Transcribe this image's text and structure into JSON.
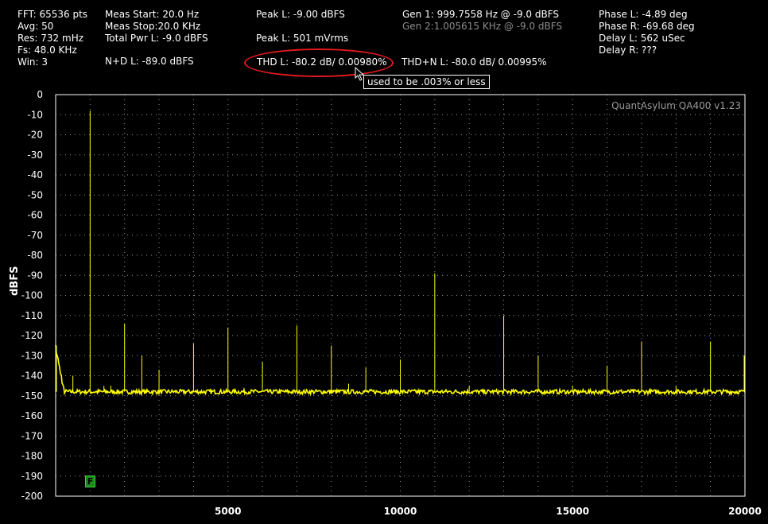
{
  "header": {
    "col1": [
      "FFT: 65536 pts",
      "Avg: 50",
      "Res: 732 mHz",
      "Fs: 48.0 KHz",
      "Win: 3"
    ],
    "col2": [
      "Meas Start: 20.0 Hz",
      "Meas Stop:20.0 KHz",
      "Total Pwr L: -9.0 dBFS"
    ],
    "nd": "N+D L: -89.0 dBFS",
    "peak_l": "Peak L: -9.00 dBFS",
    "peak_l_v": "Peak L: 501 mVrms",
    "thd": "THD L: -80.2 dB/ 0.00980%",
    "thdn": "THD+N L: -80.0 dB/ 0.00995%",
    "gen1": "Gen 1: 999.7558 Hz @ -9.0  dBFS",
    "gen2": "Gen 2:1.005615 KHz @ -9.0  dBFS",
    "col5": [
      "Phase L: -4.89 deg",
      "Phase R: -69.68 deg",
      "Delay L: 562 uSec",
      "Delay R: ???"
    ]
  },
  "annotation": {
    "note": "used to be .003% or less",
    "highlight_color": "#e1191e"
  },
  "marker_label": "F",
  "chart_data": {
    "type": "line",
    "ylabel": "dBFS",
    "xlabel": "",
    "brand": "QuantAsylum QA400 v1.23",
    "xlim": [
      0,
      20000
    ],
    "ylim": [
      -200,
      0
    ],
    "xticks": [
      5000,
      10000,
      15000,
      20000
    ],
    "yticks": [
      0,
      -10,
      -20,
      -30,
      -40,
      -50,
      -60,
      -70,
      -80,
      -90,
      -100,
      -110,
      -120,
      -130,
      -140,
      -150,
      -160,
      -170,
      -180,
      -190,
      -200
    ],
    "grid": true,
    "colors": {
      "trace": "#ffff00",
      "grid": "#bdbdbd",
      "axes": "#ffffff"
    },
    "noise_floor": -148,
    "peaks": [
      {
        "x": 0,
        "y": -125
      },
      {
        "x": 500,
        "y": -140
      },
      {
        "x": 1000,
        "y": -8
      },
      {
        "x": 1400,
        "y": -145
      },
      {
        "x": 1600,
        "y": -145
      },
      {
        "x": 2000,
        "y": -114
      },
      {
        "x": 2500,
        "y": -130
      },
      {
        "x": 3000,
        "y": -137
      },
      {
        "x": 4000,
        "y": -124
      },
      {
        "x": 5000,
        "y": -116
      },
      {
        "x": 6000,
        "y": -133
      },
      {
        "x": 7000,
        "y": -115
      },
      {
        "x": 8000,
        "y": -125
      },
      {
        "x": 8500,
        "y": -144
      },
      {
        "x": 9000,
        "y": -136
      },
      {
        "x": 10000,
        "y": -132
      },
      {
        "x": 11000,
        "y": -89
      },
      {
        "x": 12000,
        "y": -145
      },
      {
        "x": 13000,
        "y": -110
      },
      {
        "x": 14000,
        "y": -130
      },
      {
        "x": 15000,
        "y": -145
      },
      {
        "x": 16000,
        "y": -135
      },
      {
        "x": 17000,
        "y": -123
      },
      {
        "x": 18000,
        "y": -145
      },
      {
        "x": 19000,
        "y": -123
      },
      {
        "x": 20000,
        "y": -130
      }
    ]
  }
}
